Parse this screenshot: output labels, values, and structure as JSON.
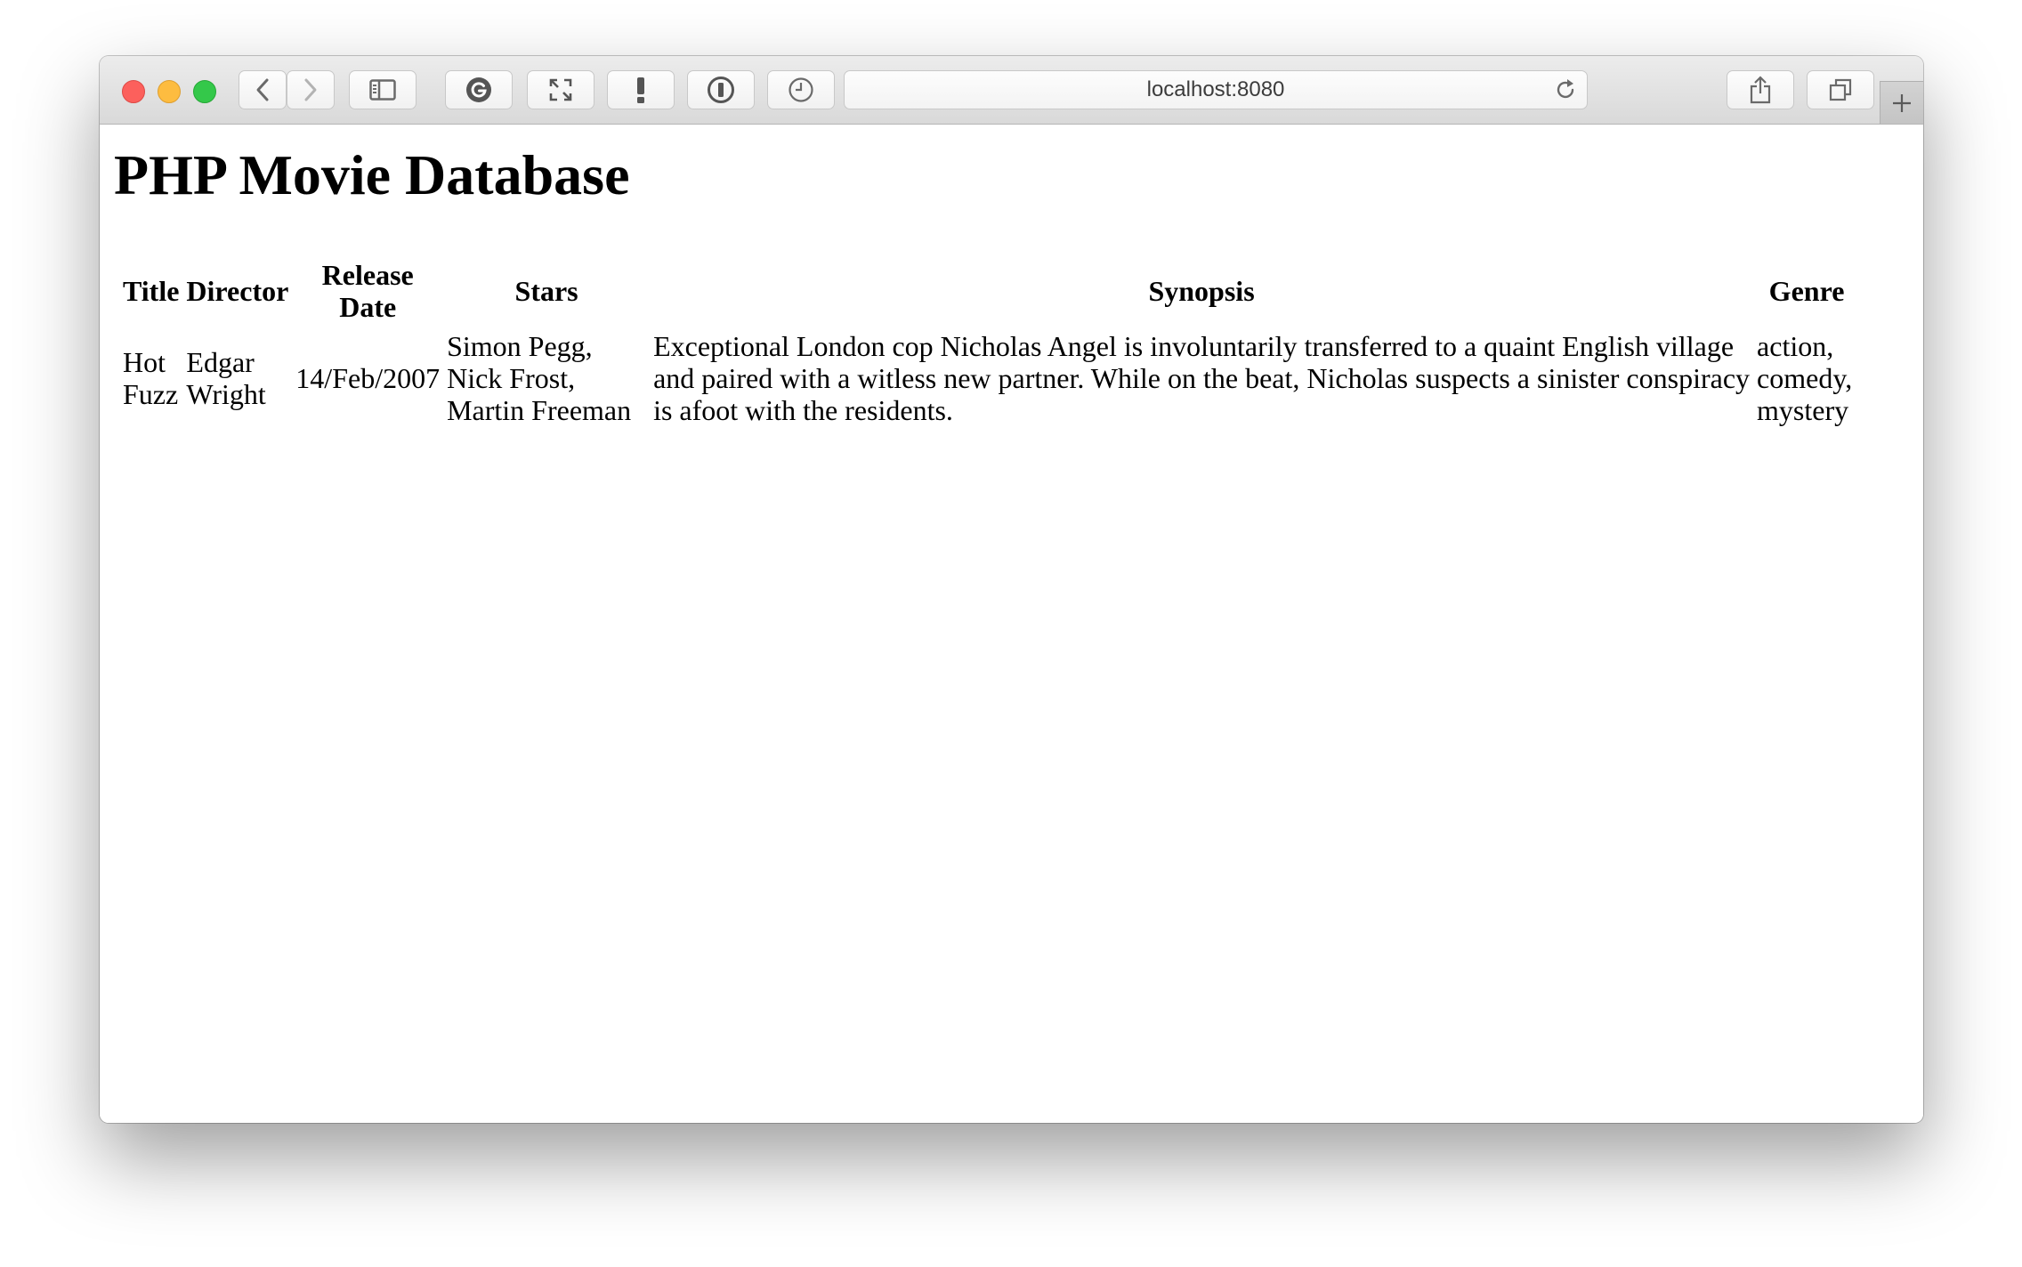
{
  "browser": {
    "url": "localhost:8080",
    "icons": {
      "back": "chevron-left-icon",
      "forward": "chevron-right-icon",
      "sidebar": "sidebar-icon",
      "grammarly": "grammarly-icon",
      "fullscreen": "expand-icon",
      "alert": "exclamation-icon",
      "password": "1password-icon",
      "history": "clock-icon",
      "reload": "reload-icon",
      "share": "share-icon",
      "tabs": "tabs-icon",
      "new_tab": "plus-icon"
    }
  },
  "page": {
    "title": "PHP Movie Database",
    "columns": {
      "title": "Title",
      "director": "Director",
      "release_line1": "Release",
      "release_line2": "Date",
      "stars": "Stars",
      "synopsis": "Synopsis",
      "genre": "Genre"
    },
    "movies": [
      {
        "title_line1": "Hot",
        "title_line2": "Fuzz",
        "director_line1": "Edgar",
        "director_line2": "Wright",
        "release_date": "14/Feb/2007",
        "stars_line1": "Simon Pegg,",
        "stars_line2": "Nick Frost,",
        "stars_line3": "Martin Freeman",
        "synopsis_line1": "Exceptional London cop Nicholas Angel is involuntarily transferred to a quaint English village",
        "synopsis_line2": "and paired with a witless new partner. While on the beat, Nicholas suspects a sinister conspiracy",
        "synopsis_line3": "is afoot with the residents.",
        "genre_line1": "action,",
        "genre_line2": "comedy,",
        "genre_line3": "mystery"
      }
    ]
  }
}
